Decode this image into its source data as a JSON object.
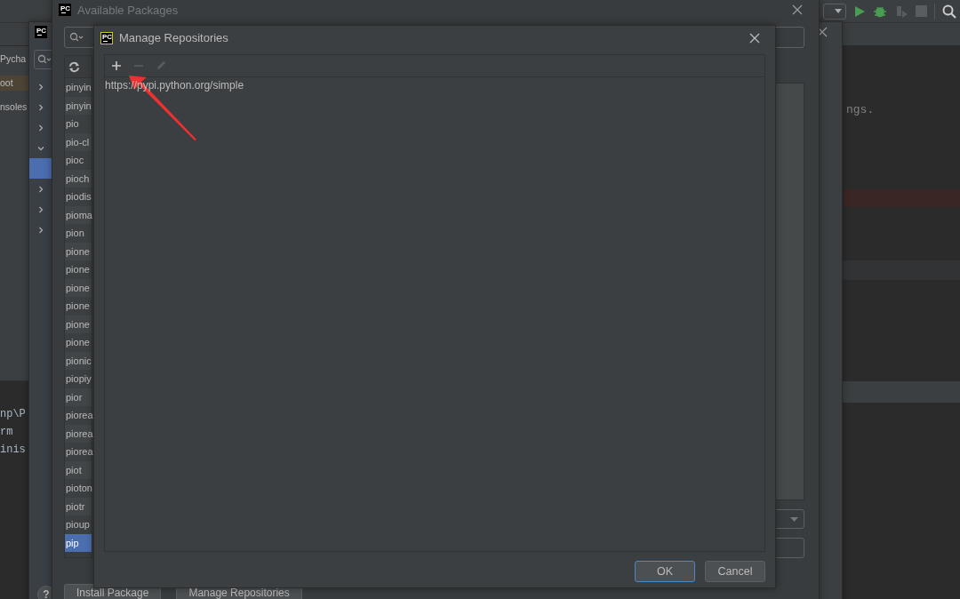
{
  "ide": {
    "project_tree": [
      {
        "label": "Pycha",
        "selected": false
      },
      {
        "label": "oot",
        "selected": true
      },
      {
        "label": "nsoles",
        "selected": false
      }
    ],
    "editor_text": "ngs.",
    "console_lines": [
      "np\\P",
      "rm",
      "inis"
    ]
  },
  "settings_window": {
    "logo": "PC",
    "tree_rows": [
      {
        "kind": "group",
        "expanded": false,
        "selected": false
      },
      {
        "kind": "group",
        "expanded": false,
        "selected": false
      },
      {
        "kind": "group",
        "expanded": false,
        "selected": false
      },
      {
        "kind": "group",
        "expanded": true,
        "selected": false
      },
      {
        "kind": "leaf",
        "selected": true
      },
      {
        "kind": "group",
        "expanded": false,
        "selected": false
      },
      {
        "kind": "group",
        "expanded": false,
        "selected": false
      },
      {
        "kind": "group",
        "expanded": false,
        "selected": false
      }
    ],
    "help": "?"
  },
  "available_packages": {
    "logo": "PC",
    "title": "Available Packages",
    "packages": [
      {
        "name": "pinyin",
        "selected": false
      },
      {
        "name": "pinyin",
        "selected": false
      },
      {
        "name": "pio",
        "selected": false
      },
      {
        "name": "pio-cl",
        "selected": false
      },
      {
        "name": "pioc",
        "selected": false
      },
      {
        "name": "pioch",
        "selected": false
      },
      {
        "name": "piodis",
        "selected": false
      },
      {
        "name": "pioma",
        "selected": false
      },
      {
        "name": "pion",
        "selected": false
      },
      {
        "name": "pione",
        "selected": false
      },
      {
        "name": "pione",
        "selected": false
      },
      {
        "name": "pione",
        "selected": false
      },
      {
        "name": "pione",
        "selected": false
      },
      {
        "name": "pione",
        "selected": false
      },
      {
        "name": "pione",
        "selected": false
      },
      {
        "name": "pionic",
        "selected": false
      },
      {
        "name": "piopiy",
        "selected": false
      },
      {
        "name": "pior",
        "selected": false
      },
      {
        "name": "piorea",
        "selected": false
      },
      {
        "name": "piorea",
        "selected": false
      },
      {
        "name": "piorea",
        "selected": false
      },
      {
        "name": "piot",
        "selected": false
      },
      {
        "name": "pioton",
        "selected": false
      },
      {
        "name": "piotr",
        "selected": false
      },
      {
        "name": "pioup",
        "selected": false
      },
      {
        "name": "pip",
        "selected": true
      }
    ],
    "buttons": [
      "Install Package",
      "Manage Repositories"
    ]
  },
  "manage_repositories": {
    "logo": "PC",
    "title": "Manage Repositories",
    "toolbar": [
      {
        "kind": "add",
        "disabled": false
      },
      {
        "kind": "remove",
        "disabled": true
      },
      {
        "kind": "edit",
        "disabled": true
      }
    ],
    "repositories": [
      {
        "url": "https://pypi.python.org/simple"
      }
    ],
    "buttons": [
      {
        "label": "OK",
        "default": true
      },
      {
        "label": "Cancel",
        "default": false
      }
    ]
  }
}
